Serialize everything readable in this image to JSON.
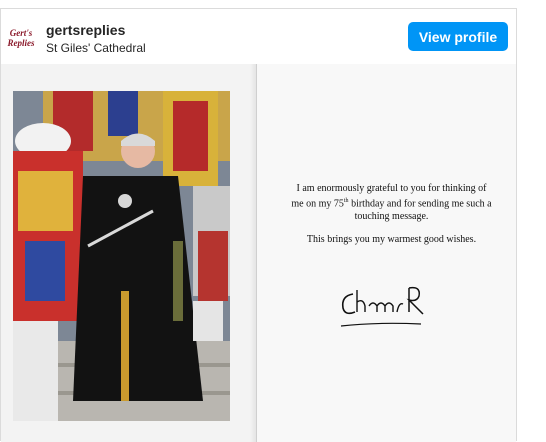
{
  "header": {
    "avatar_line1": "Gert's",
    "avatar_line2": "Replies",
    "username": "gertsreplies",
    "location": "St Giles' Cathedral",
    "view_profile_label": "View profile"
  },
  "card": {
    "message_line1": "I am enormously grateful to you for thinking of",
    "message_line2_a": "me on my 75",
    "message_line2_sup": "th",
    "message_line2_b": " birthday and for sending me such a",
    "message_line3": "touching message.",
    "wishes": "This brings you my warmest good wishes.",
    "signature": "Charles R"
  },
  "colors": {
    "button": "#0095f6",
    "avatar_text": "#8b1a2b"
  }
}
